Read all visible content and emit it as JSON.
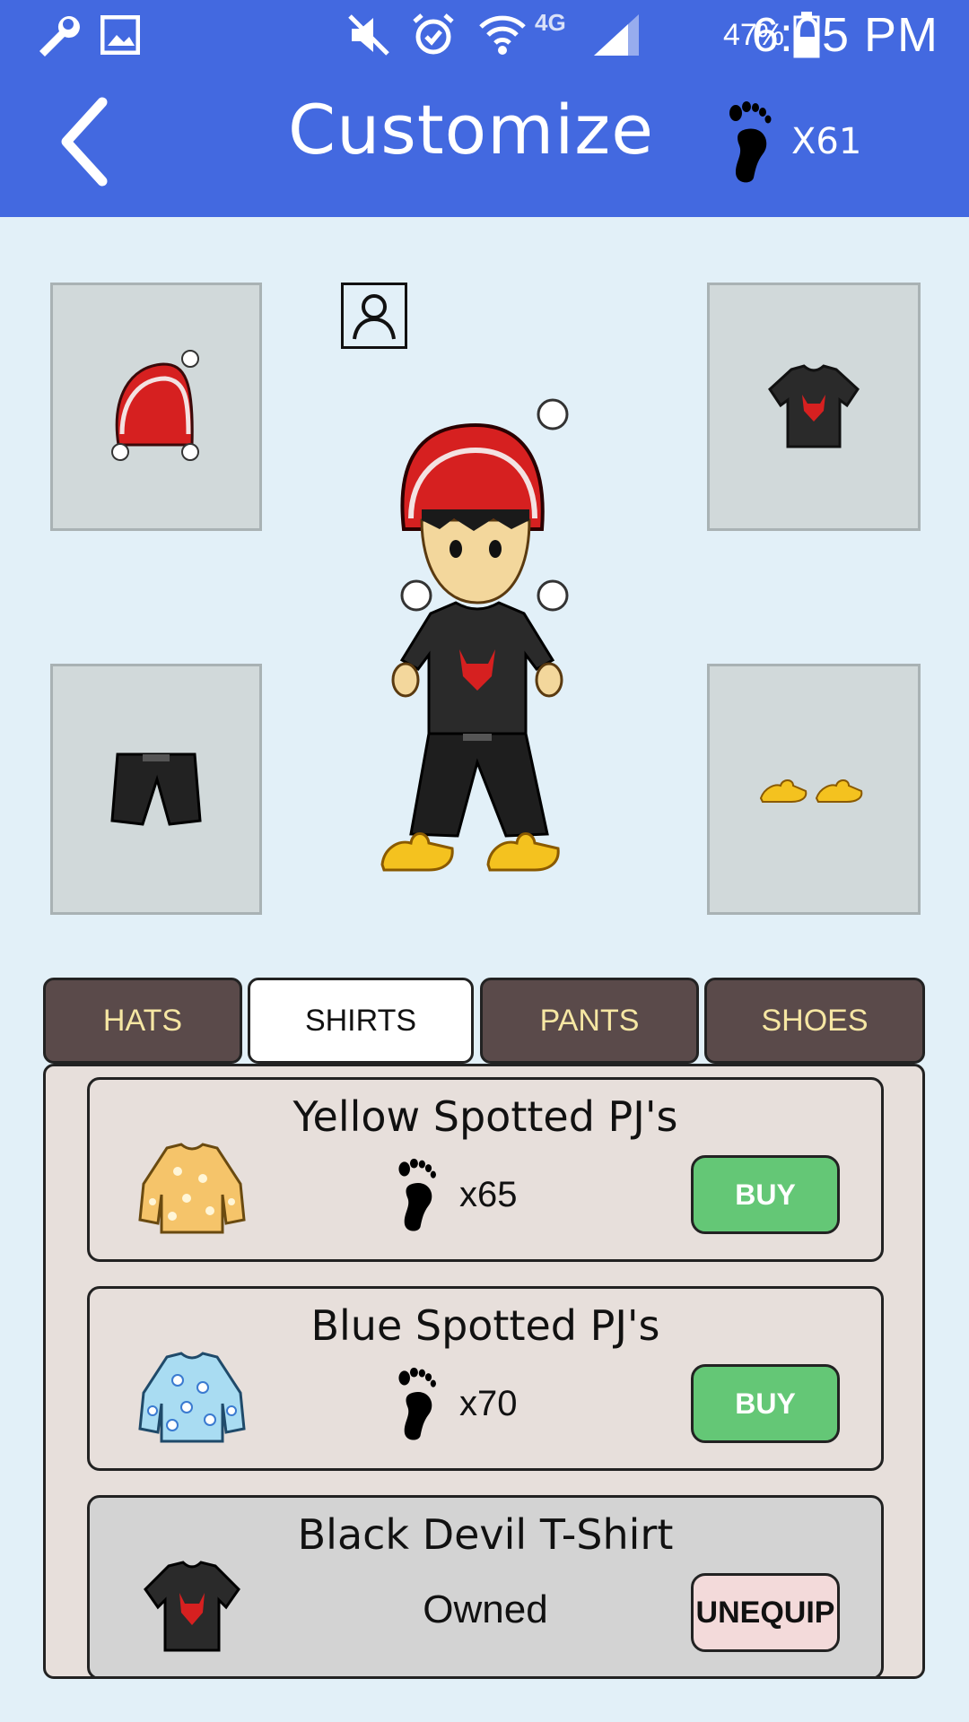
{
  "status_bar": {
    "network": "4G",
    "battery": "47%",
    "time": "6:05 PM",
    "icons": [
      "wrench-icon",
      "image-icon",
      "mute-icon",
      "alarm-icon",
      "wifi-icon",
      "signal-icon",
      "battery-icon"
    ]
  },
  "header": {
    "title": "Customize",
    "currency": "X61",
    "currency_icon": "footprint-icon"
  },
  "equipped": {
    "hat": "hat-slot",
    "shirt": "shirt-slot",
    "pants": "pants-slot",
    "shoes": "shoes-slot"
  },
  "tabs": [
    {
      "label": "HATS",
      "active": false
    },
    {
      "label": "SHIRTS",
      "active": true
    },
    {
      "label": "PANTS",
      "active": false
    },
    {
      "label": "SHOES",
      "active": false
    }
  ],
  "items": [
    {
      "name": "Yellow Spotted PJ's",
      "price": "x65",
      "button": "BUY",
      "owned": false
    },
    {
      "name": "Blue Spotted PJ's",
      "price": "x70",
      "button": "BUY",
      "owned": false
    },
    {
      "name": "Black Devil T-Shirt",
      "status": "Owned",
      "button": "UNEQUIP",
      "owned": true
    }
  ],
  "colors": {
    "header": "#4369e0",
    "background": "#e2f0f8",
    "tab_inactive": "#5a4a4a",
    "tab_text": "#f6e7a3",
    "buy": "#64c776",
    "unequip": "#f3dada"
  }
}
